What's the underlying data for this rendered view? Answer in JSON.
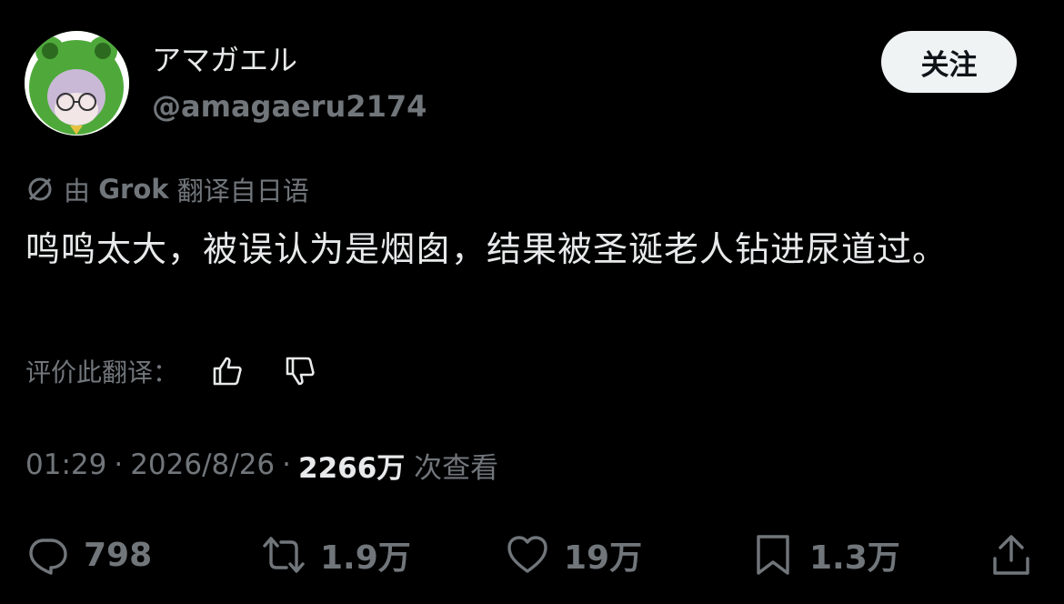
{
  "user": {
    "display_name": "アマガエル",
    "handle": "@amagaeru2174"
  },
  "follow_button": {
    "label": "关注"
  },
  "translation": {
    "prefix": "由",
    "engine": "Grok",
    "suffix": "翻译自日语"
  },
  "post": {
    "text": "鸣鸣太大，被误认为是烟囱，结果被圣诞老人钻进尿道过。"
  },
  "rating": {
    "label": "评价此翻译："
  },
  "meta": {
    "time": "01:29",
    "date": "2026/8/26",
    "views": "2266万",
    "views_label": "次查看"
  },
  "actions": {
    "replies": "798",
    "reposts": "1.9万",
    "likes": "19万",
    "bookmarks": "1.3万"
  },
  "colors": {
    "background": "#000000",
    "text_primary": "#e7e9ea",
    "text_secondary": "#71767b",
    "button_bg": "#eff3f4"
  },
  "icons": [
    "translate-slash-icon",
    "thumbs-up-icon",
    "thumbs-down-icon",
    "reply-icon",
    "repost-icon",
    "like-icon",
    "bookmark-icon",
    "share-icon"
  ]
}
